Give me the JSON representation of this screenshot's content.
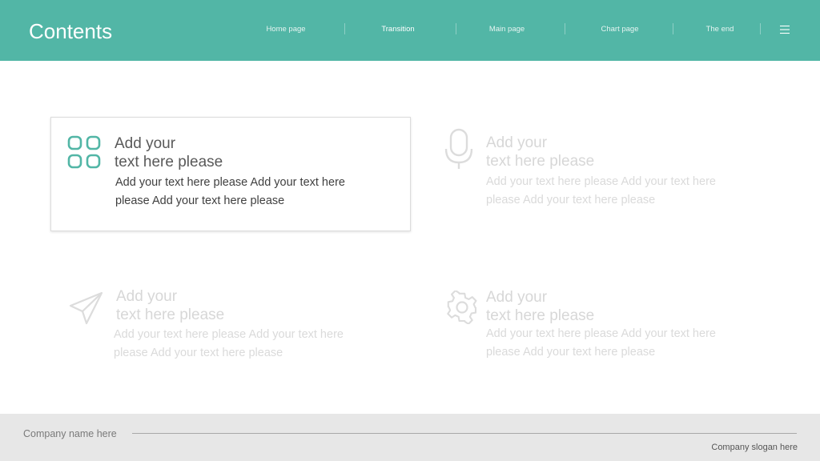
{
  "header": {
    "title": "Contents",
    "nav": [
      {
        "label": "Home  page"
      },
      {
        "label": "Transition"
      },
      {
        "label": "Main page"
      },
      {
        "label": "Chart page"
      },
      {
        "label": "The end"
      }
    ],
    "active_index": 1,
    "menu_icon": "hamburger-menu-icon"
  },
  "items": [
    {
      "icon": "grid-icon",
      "title_line1": "Add your",
      "title_line2": "text here please",
      "body_line1": "Add your text here please Add your text here",
      "body_line2": "please Add your text here please",
      "style": "dark"
    },
    {
      "icon": "microphone-icon",
      "title_line1": "Add your",
      "title_line2": "text here please",
      "body_line1": "Add your text here please Add your text here",
      "body_line2": "please Add your text here please",
      "style": "faded"
    },
    {
      "icon": "paper-plane-icon",
      "title_line1": "Add your",
      "title_line2": "text here please",
      "body_line1": "Add your text here please Add your text here",
      "body_line2": "please Add your text here please",
      "style": "faded"
    },
    {
      "icon": "gear-icon",
      "title_line1": "Add your",
      "title_line2": "text here please",
      "body_line1": "Add your text here please Add your text here",
      "body_line2": "please Add your text here please",
      "style": "faded"
    }
  ],
  "footer": {
    "company": "Company name here",
    "slogan": "Company slogan here"
  },
  "colors": {
    "accent": "#52b6a6",
    "footer_bg": "#e7e7e7",
    "faded_text": "#d7d7d7",
    "dark_text": "#404040"
  }
}
